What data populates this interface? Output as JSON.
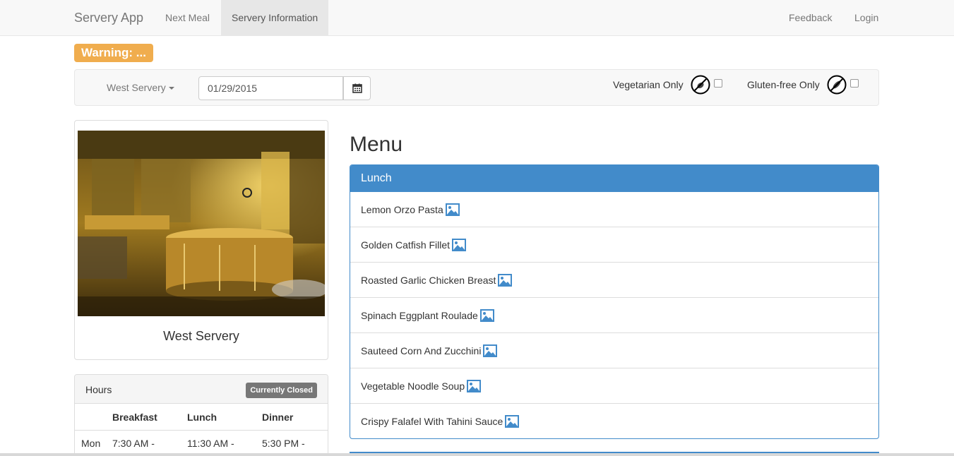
{
  "nav": {
    "brand": "Servery App",
    "links": [
      "Next Meal",
      "Servery Information"
    ],
    "right_links": [
      "Feedback",
      "Login"
    ]
  },
  "warning": "Warning: ...",
  "filters": {
    "servery": "West Servery",
    "date": "01/29/2015",
    "vegetarian_label": "Vegetarian Only",
    "gluten_label": "Gluten-free Only"
  },
  "servery_card": {
    "name": "West Servery"
  },
  "hours": {
    "title": "Hours",
    "status": "Currently Closed",
    "columns": [
      "Breakfast",
      "Lunch",
      "Dinner"
    ],
    "rows": [
      {
        "day": "Mon",
        "breakfast": "7:30 AM -",
        "lunch": "11:30 AM -",
        "dinner": "5:30 PM -"
      }
    ]
  },
  "menu": {
    "heading": "Menu",
    "meal": "Lunch",
    "items": [
      "Lemon Orzo Pasta",
      "Golden Catfish Fillet",
      "Roasted Garlic Chicken Breast",
      "Spinach Eggplant Roulade",
      "Sauteed Corn And Zucchini",
      "Vegetable Noodle Soup",
      "Crispy Falafel With Tahini Sauce"
    ]
  },
  "colors": {
    "primary": "#428bca",
    "warning": "#f0ad4e",
    "badge": "#777777"
  }
}
